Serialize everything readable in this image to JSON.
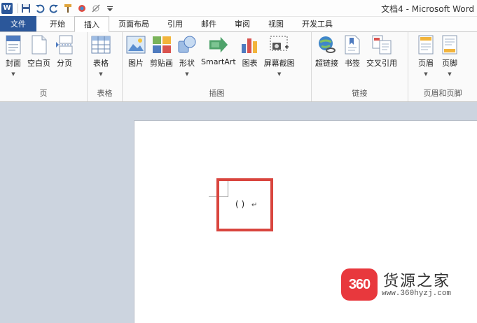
{
  "app": {
    "title": "文档4 - Microsoft Word",
    "logo_letter": "W"
  },
  "tabs": [
    {
      "label": "文件"
    },
    {
      "label": "开始"
    },
    {
      "label": "插入"
    },
    {
      "label": "页面布局"
    },
    {
      "label": "引用"
    },
    {
      "label": "邮件"
    },
    {
      "label": "审阅"
    },
    {
      "label": "视图"
    },
    {
      "label": "开发工具"
    }
  ],
  "active_tab": "插入",
  "ribbon": {
    "groups": {
      "pages": {
        "label": "页",
        "buttons": [
          "封面",
          "空白页",
          "分页"
        ]
      },
      "tables": {
        "label": "表格",
        "buttons": [
          "表格"
        ]
      },
      "illustrations": {
        "label": "插图",
        "buttons": [
          "图片",
          "剪贴画",
          "形状",
          "SmartArt",
          "图表",
          "屏幕截图"
        ]
      },
      "links": {
        "label": "链接",
        "buttons": [
          "超链接",
          "书签",
          "交叉引用"
        ]
      },
      "header_footer": {
        "label": "页眉和页脚",
        "buttons": [
          "页眉",
          "页脚"
        ]
      }
    }
  },
  "document": {
    "content": "( )",
    "paragraph_mark": "↵"
  },
  "watermark": {
    "logo_text": "360",
    "title": "货源之家",
    "url": "www.360hyzj.com"
  },
  "colors": {
    "file_tab": "#2b579a",
    "highlight_box": "#d9453e",
    "watermark_logo": "#e8383d"
  }
}
